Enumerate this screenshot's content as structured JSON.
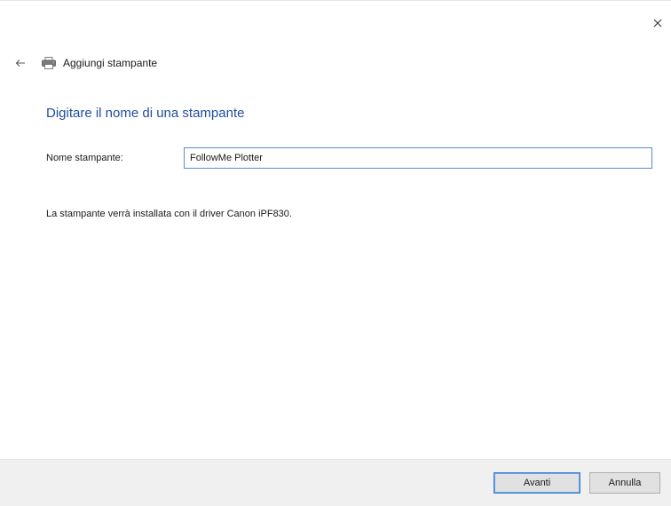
{
  "window": {
    "title": "Aggiungi stampante"
  },
  "icons": {
    "close": "close-icon",
    "back": "back-arrow-icon",
    "printer": "printer-icon"
  },
  "main": {
    "heading": "Digitare il nome di una stampante",
    "name_label": "Nome stampante:",
    "name_value": "FollowMe Plotter",
    "driver_note": "La stampante verrà installata con il driver Canon iPF830."
  },
  "footer": {
    "next_label": "Avanti",
    "cancel_label": "Annulla"
  },
  "colors": {
    "heading": "#1f4e9c",
    "input_border": "#5b8ad6",
    "footer_bg": "#f0f0f0"
  }
}
